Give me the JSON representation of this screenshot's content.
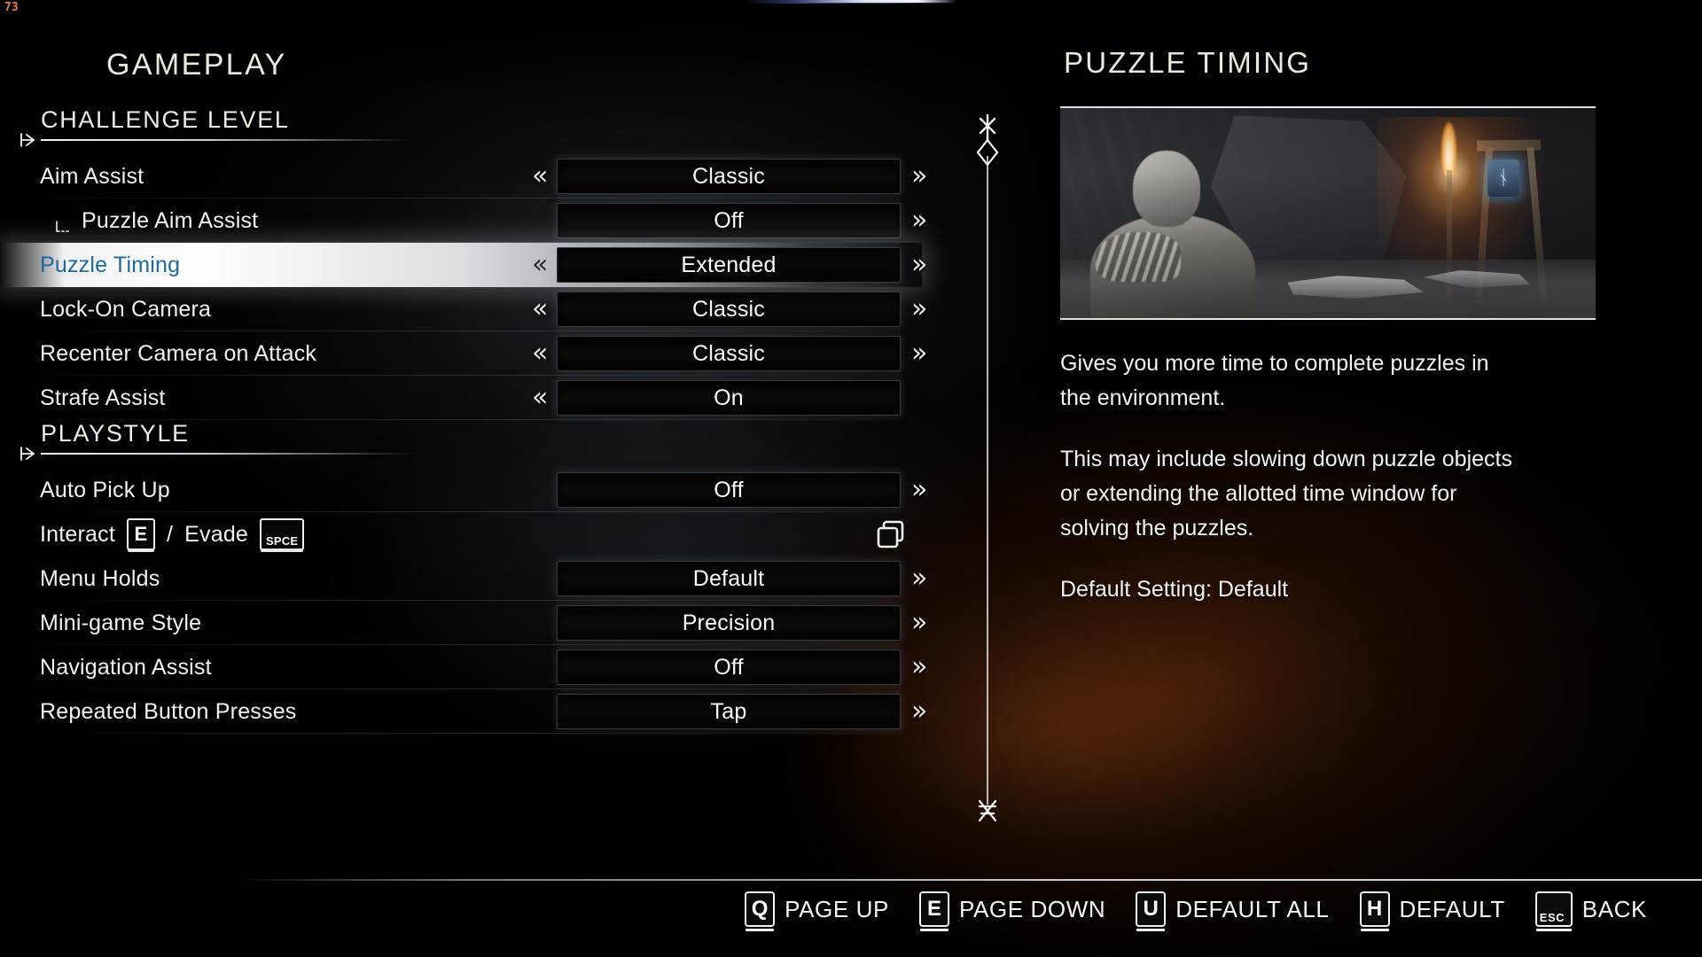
{
  "hud": {
    "fps": "73"
  },
  "left_panel": {
    "title": "GAMEPLAY",
    "sections": [
      {
        "heading": "CHALLENGE LEVEL",
        "rows": [
          {
            "label": "Aim Assist",
            "value": "Classic",
            "sub": false,
            "selected": false,
            "left_arrow": "«",
            "right_arrow": "»",
            "has_left": true,
            "has_right": true
          },
          {
            "label": "Puzzle Aim Assist",
            "value": "Off",
            "sub": true,
            "selected": false,
            "left_arrow": "«",
            "right_arrow": "»",
            "has_left": false,
            "has_right": true
          },
          {
            "label": "Puzzle Timing",
            "value": "Extended",
            "sub": false,
            "selected": true,
            "left_arrow": "«",
            "right_arrow": "»",
            "has_left": true,
            "has_right": true
          },
          {
            "label": "Lock-On Camera",
            "value": "Classic",
            "sub": false,
            "selected": false,
            "left_arrow": "«",
            "right_arrow": "»",
            "has_left": true,
            "has_right": true
          },
          {
            "label": "Recenter Camera on Attack",
            "value": "Classic",
            "sub": false,
            "selected": false,
            "left_arrow": "«",
            "right_arrow": "»",
            "has_left": true,
            "has_right": true
          },
          {
            "label": "Strafe Assist",
            "value": "On",
            "sub": false,
            "selected": false,
            "left_arrow": "«",
            "right_arrow": "»",
            "has_left": true,
            "has_right": false
          }
        ]
      },
      {
        "heading": "PLAYSTYLE",
        "rows": [
          {
            "label": "Auto Pick Up",
            "value": "Off",
            "sub": false,
            "selected": false,
            "left_arrow": "«",
            "right_arrow": "»",
            "has_left": false,
            "has_right": true
          },
          {
            "label": "__BINDING_ROW__",
            "value": "",
            "sub": false,
            "selected": false,
            "left_arrow": "",
            "right_arrow": "",
            "has_left": false,
            "has_right": false
          },
          {
            "label": "Menu Holds",
            "value": "Default",
            "sub": false,
            "selected": false,
            "left_arrow": "«",
            "right_arrow": "»",
            "has_left": false,
            "has_right": true
          },
          {
            "label": "Mini-game Style",
            "value": "Precision",
            "sub": false,
            "selected": false,
            "left_arrow": "«",
            "right_arrow": "»",
            "has_left": false,
            "has_right": true
          },
          {
            "label": "Navigation Assist",
            "value": "Off",
            "sub": false,
            "selected": false,
            "left_arrow": "«",
            "right_arrow": "»",
            "has_left": false,
            "has_right": true
          },
          {
            "label": "Repeated Button Presses",
            "value": "Tap",
            "sub": false,
            "selected": false,
            "left_arrow": "«",
            "right_arrow": "»",
            "has_left": false,
            "has_right": true
          }
        ]
      }
    ],
    "binding_row": {
      "interact_label": "Interact",
      "interact_key": "E",
      "separator": "/",
      "evade_label": "Evade",
      "evade_key": "SPCE",
      "toggle_icon": "duplicate-squares-icon"
    }
  },
  "right_panel": {
    "title": "PUZZLE TIMING",
    "preview_alt": "puzzle-timing-preview",
    "description": [
      "Gives you more time to complete puzzles in the environment.",
      "This may include slowing down puzzle objects or extending the allotted time window for solving the puzzles.",
      "Default Setting: Default"
    ]
  },
  "footer": {
    "hints": [
      {
        "key": "Q",
        "label": "PAGE UP",
        "style": "normal"
      },
      {
        "key": "E",
        "label": "PAGE DOWN",
        "style": "normal"
      },
      {
        "key": "U",
        "label": "DEFAULT ALL",
        "style": "normal"
      },
      {
        "key": "H",
        "label": "DEFAULT",
        "style": "normal"
      },
      {
        "key": "ESC",
        "label": "BACK",
        "style": "esc"
      }
    ]
  },
  "colors": {
    "accent_selected_text": "#1c6a9e",
    "heading": "#ece9de",
    "body_text": "#f4f4f4",
    "fps": "#e8823c",
    "rune_glow": "#569eDC"
  }
}
